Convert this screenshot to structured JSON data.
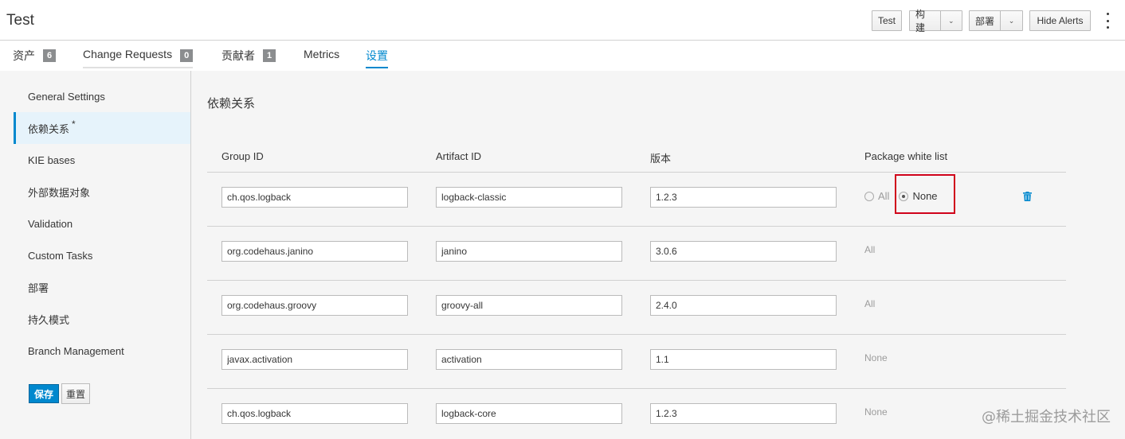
{
  "header": {
    "title": "Test",
    "buttons": {
      "test": "Test",
      "build": "构建",
      "deploy": "部署",
      "hide_alerts": "Hide Alerts"
    }
  },
  "tabs": [
    {
      "label": "资产",
      "count": "6"
    },
    {
      "label": "Change Requests",
      "count": "0"
    },
    {
      "label": "贡献者",
      "count": "1"
    },
    {
      "label": "Metrics"
    },
    {
      "label": "设置"
    }
  ],
  "sidebar": {
    "items": [
      {
        "label": "General Settings"
      },
      {
        "label": "依赖关系",
        "marker": "*"
      },
      {
        "label": "KIE bases"
      },
      {
        "label": "外部数据对象"
      },
      {
        "label": "Validation"
      },
      {
        "label": "Custom Tasks"
      },
      {
        "label": "部署"
      },
      {
        "label": "持久模式"
      },
      {
        "label": "Branch Management"
      }
    ],
    "save_label": "保存",
    "reset_label": "重置"
  },
  "section": {
    "title": "依赖关系",
    "columns": {
      "group_id": "Group ID",
      "artifact_id": "Artifact ID",
      "version": "版本",
      "whitelist": "Package white list"
    },
    "rows": [
      {
        "group_id": "ch.qos.logback",
        "artifact_id": "logback-classic",
        "version": "1.2.3",
        "whitelist": "",
        "options": {
          "all": "All",
          "none": "None"
        }
      },
      {
        "group_id": "org.codehaus.janino",
        "artifact_id": "janino",
        "version": "3.0.6",
        "whitelist": "All"
      },
      {
        "group_id": "org.codehaus.groovy",
        "artifact_id": "groovy-all",
        "version": "2.4.0",
        "whitelist": "All"
      },
      {
        "group_id": "javax.activation",
        "artifact_id": "activation",
        "version": "1.1",
        "whitelist": "None"
      },
      {
        "group_id": "ch.qos.logback",
        "artifact_id": "logback-core",
        "version": "1.2.3",
        "whitelist": "None"
      }
    ]
  },
  "watermark": "@稀土掘金技术社区",
  "colors": {
    "accent": "#0088ce",
    "highlight": "#d0021b",
    "badge": "#8b8d8f"
  }
}
